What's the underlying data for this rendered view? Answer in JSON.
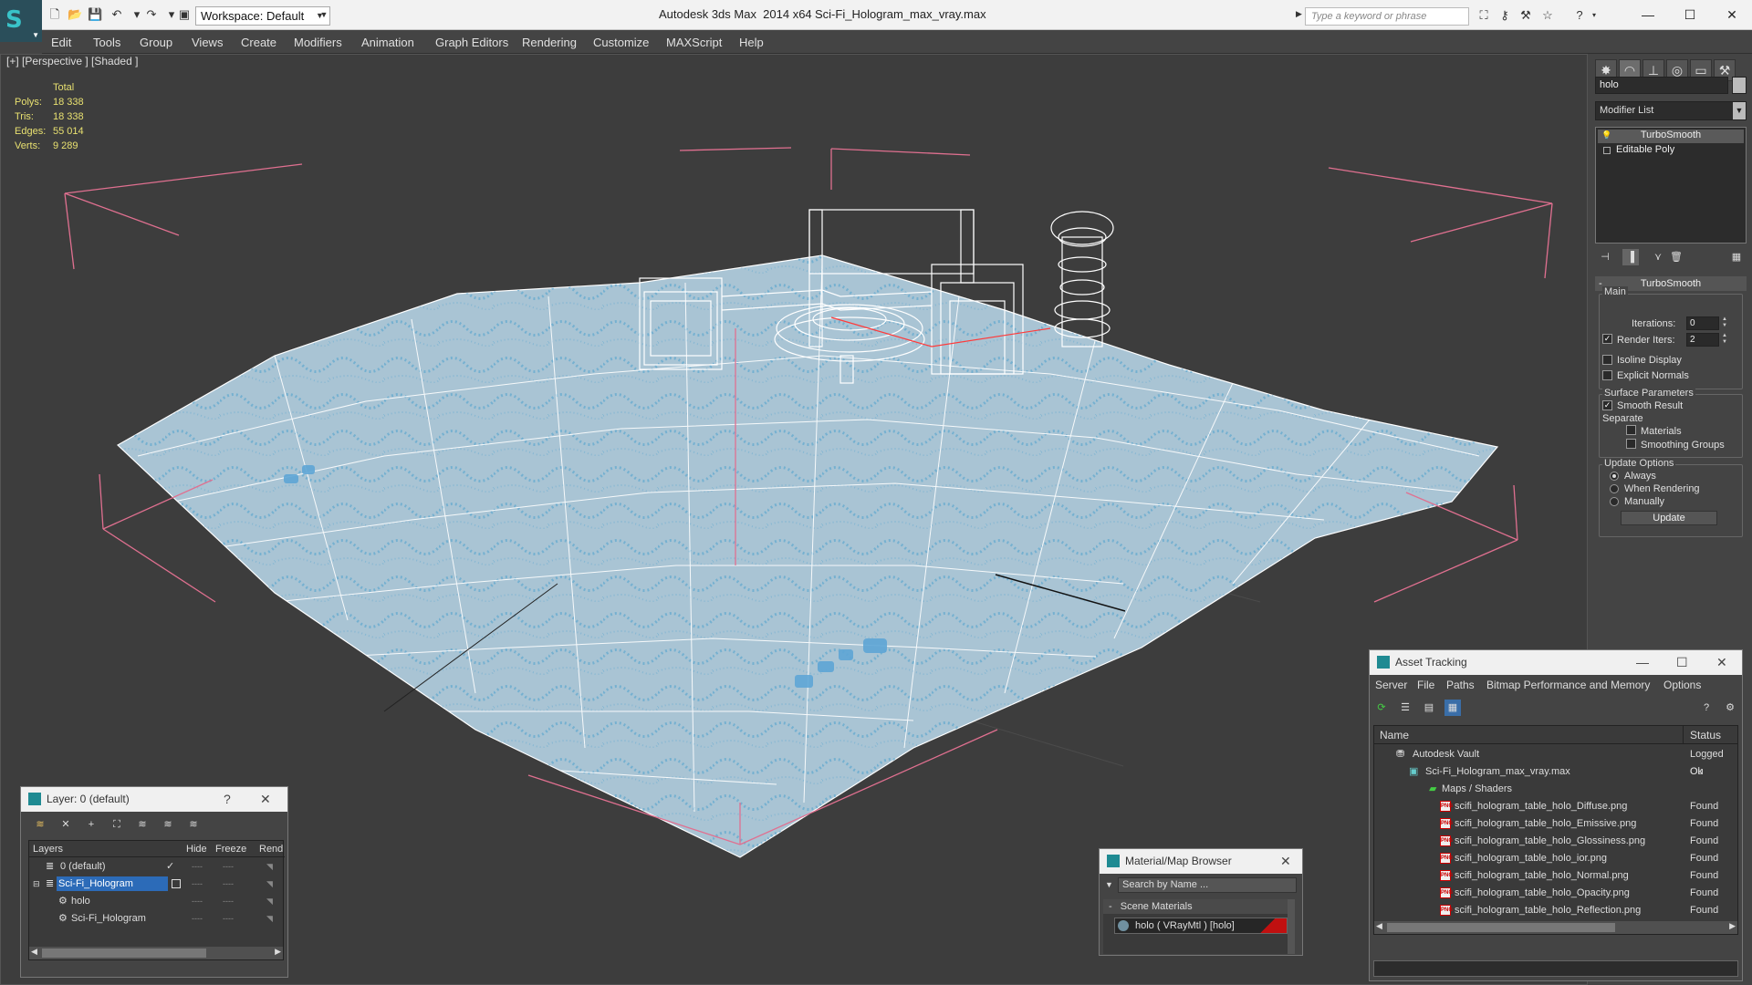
{
  "app": {
    "title": "Autodesk 3ds Max  2014 x64",
    "file": "Sci-Fi_Hologram_max_vray.max",
    "workspace": "Workspace: Default",
    "search_placeholder": "Type a keyword or phrase"
  },
  "menu": [
    "Edit",
    "Tools",
    "Group",
    "Views",
    "Create",
    "Modifiers",
    "Animation",
    "Graph Editors",
    "Rendering",
    "Customize",
    "MAXScript",
    "Help"
  ],
  "viewport": {
    "label": "[+] [Perspective ] [Shaded ]",
    "stats": {
      "header": "Total",
      "rows": [
        {
          "k": "Polys:",
          "v": "18 338"
        },
        {
          "k": "Tris:",
          "v": "18 338"
        },
        {
          "k": "Edges:",
          "v": "55 014"
        },
        {
          "k": "Verts:",
          "v": "9 289"
        }
      ]
    }
  },
  "command_panel": {
    "object_name": "holo",
    "modifier_list": "Modifier List",
    "stack": [
      "TurboSmooth",
      "Editable Poly"
    ],
    "rollout_title": "TurboSmooth",
    "main_group": "Main",
    "iterations_label": "Iterations:",
    "iterations_value": "0",
    "render_iters_label": "Render Iters:",
    "render_iters_value": "2",
    "isoline_display": "Isoline Display",
    "explicit_normals": "Explicit Normals",
    "surface_params": "Surface Parameters",
    "smooth_result": "Smooth Result",
    "separate": "Separate",
    "materials": "Materials",
    "smoothing_groups": "Smoothing Groups",
    "update_options": "Update Options",
    "always": "Always",
    "when_rendering": "When Rendering",
    "manually": "Manually",
    "update_button": "Update"
  },
  "layer_window": {
    "title": "Layer: 0 (default)",
    "help": "?",
    "columns": [
      "Layers",
      "Hide",
      "Freeze",
      "Rend"
    ],
    "rows": [
      {
        "name": "0 (default)",
        "indent": 0
      },
      {
        "name": "Sci-Fi_Hologram",
        "indent": 0
      },
      {
        "name": "holo",
        "indent": 1
      },
      {
        "name": "Sci-Fi_Hologram",
        "indent": 1
      }
    ]
  },
  "material_browser": {
    "title": "Material/Map Browser",
    "search": "Search by Name ...",
    "section": "Scene Materials",
    "item": "holo  ( VRayMtl ) [holo]"
  },
  "asset_tracking": {
    "title": "Asset Tracking",
    "menu": [
      "Server",
      "File",
      "Paths",
      "Bitmap Performance and Memory",
      "Options"
    ],
    "columns": [
      "Name",
      "Status"
    ],
    "rows": [
      {
        "name": "Autodesk Vault",
        "status": "Logged Ou",
        "level": 0,
        "icon": "vault"
      },
      {
        "name": "Sci-Fi_Hologram_max_vray.max",
        "status": "Ok",
        "level": 1,
        "icon": "max"
      },
      {
        "name": "Maps / Shaders",
        "status": "",
        "level": 2,
        "icon": "folder"
      },
      {
        "name": "scifi_hologram_table_holo_Diffuse.png",
        "status": "Found",
        "level": 3,
        "icon": "png"
      },
      {
        "name": "scifi_hologram_table_holo_Emissive.png",
        "status": "Found",
        "level": 3,
        "icon": "png"
      },
      {
        "name": "scifi_hologram_table_holo_Glossiness.png",
        "status": "Found",
        "level": 3,
        "icon": "png"
      },
      {
        "name": "scifi_hologram_table_holo_ior.png",
        "status": "Found",
        "level": 3,
        "icon": "png"
      },
      {
        "name": "scifi_hologram_table_holo_Normal.png",
        "status": "Found",
        "level": 3,
        "icon": "png"
      },
      {
        "name": "scifi_hologram_table_holo_Opacity.png",
        "status": "Found",
        "level": 3,
        "icon": "png"
      },
      {
        "name": "scifi_hologram_table_holo_Reflection.png",
        "status": "Found",
        "level": 3,
        "icon": "png"
      }
    ]
  }
}
